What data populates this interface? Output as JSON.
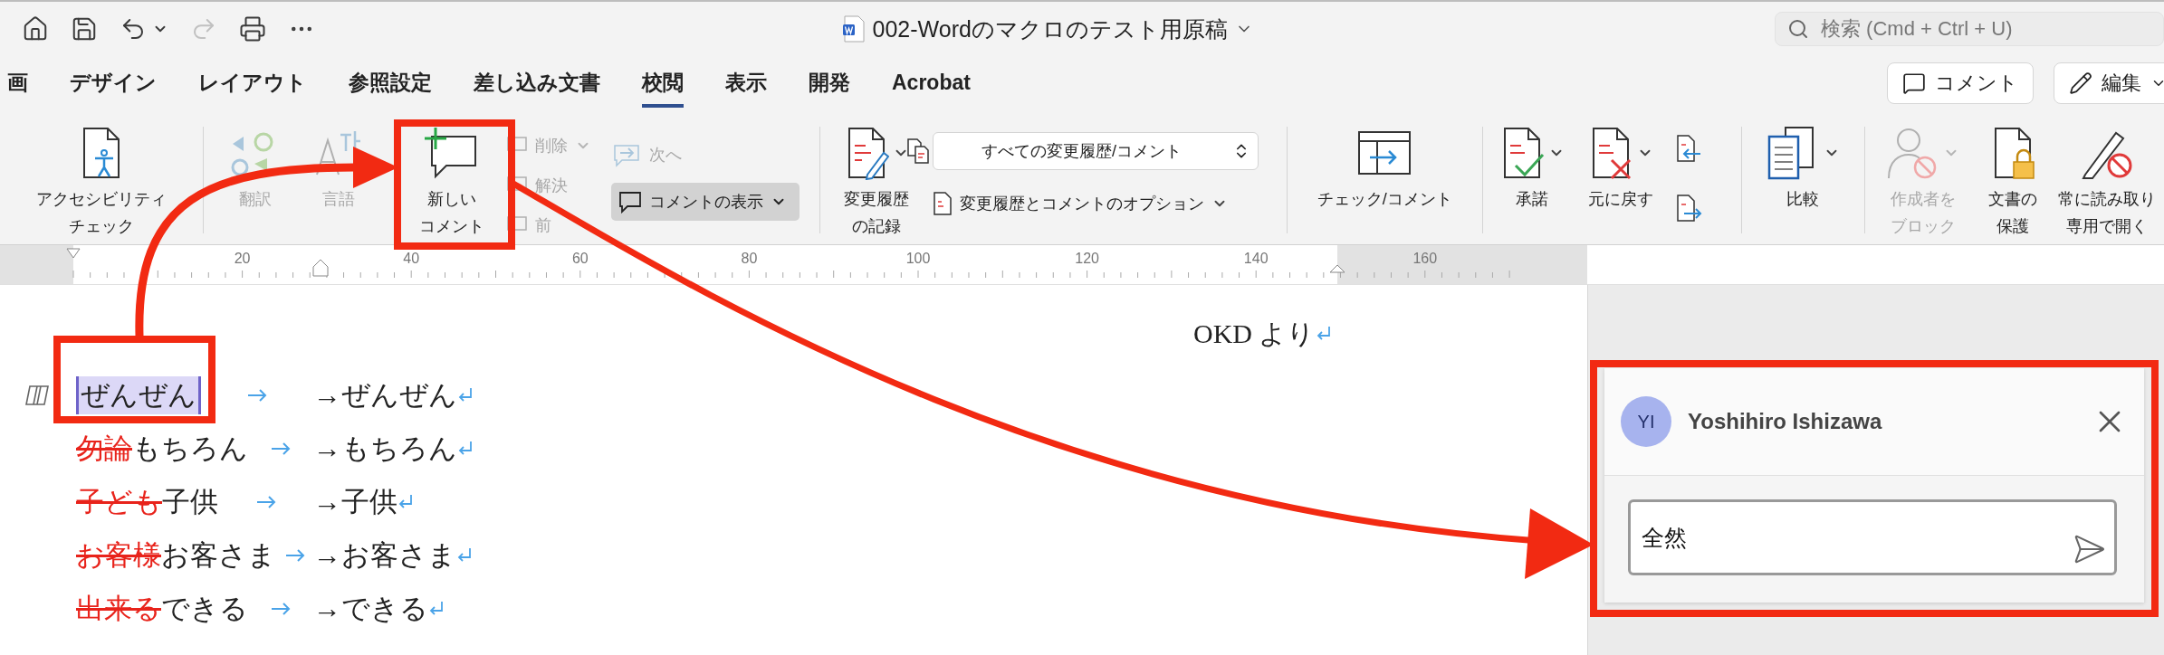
{
  "title_bar": {
    "title": "002-Wordのマクロのテスト用原稿",
    "search": {
      "placeholder": "検索 (Cmd + Ctrl + U)"
    }
  },
  "tabs": [
    {
      "label": "画",
      "selected": false
    },
    {
      "label": "デザイン",
      "selected": false
    },
    {
      "label": "レイアウト",
      "selected": false
    },
    {
      "label": "参照設定",
      "selected": false
    },
    {
      "label": "差し込み文書",
      "selected": false
    },
    {
      "label": "校閲",
      "selected": true
    },
    {
      "label": "表示",
      "selected": false
    },
    {
      "label": "開発",
      "selected": false
    },
    {
      "label": "Acrobat",
      "selected": false
    }
  ],
  "header_buttons": [
    {
      "label": "コメント"
    },
    {
      "label": "編集"
    }
  ],
  "ribbon": {
    "accessibility_check": {
      "label": [
        "アクセシビリティ",
        "チェック"
      ]
    },
    "translate": {
      "label": "翻訳",
      "disabled": true
    },
    "language": {
      "label": "言語",
      "disabled": true
    },
    "new_comment": {
      "label": [
        "新しい",
        "コメント"
      ]
    },
    "delete": {
      "label": "削除",
      "disabled": true
    },
    "resolve": {
      "label": "解決",
      "disabled": true
    },
    "previous": {
      "label": "前",
      "disabled": true
    },
    "next": {
      "label": "次へ",
      "disabled": true
    },
    "show_comments": {
      "label": "コメントの表示",
      "selected": true
    },
    "track_changes": {
      "label": [
        "変更履歴",
        "の記録"
      ]
    },
    "markup_select": {
      "value": "すべての変更履歴/コメント"
    },
    "markup_options": {
      "label": "変更履歴とコメントのオプション"
    },
    "check_comment": {
      "label": "チェック/コメント"
    },
    "accept": {
      "label": "承諾"
    },
    "reject": {
      "label": "元に戻す"
    },
    "compare": {
      "label": "比較"
    },
    "block_authors": {
      "label": [
        "作成者を",
        "ブロック"
      ],
      "disabled": true
    },
    "protect": {
      "label": [
        "文書の",
        "保護"
      ]
    },
    "read_only": {
      "label": [
        "常に読み取り",
        "専用で開く"
      ]
    }
  },
  "ruler": {
    "marks": [
      "20",
      "40",
      "60",
      "80",
      "100",
      "120",
      "140",
      "160"
    ]
  },
  "document": {
    "signature": "OKD より",
    "lines": [
      {
        "text": "ぜんぜん",
        "result": "→ぜんぜん",
        "commented": true
      },
      {
        "deleted": "勿論",
        "text": "もちろん",
        "result": "→もちろん",
        "commented": false
      },
      {
        "deleted": "子ども",
        "text": "子供",
        "result": "→子供",
        "commented": false
      },
      {
        "deleted": "お客様",
        "text": "お客さま",
        "result": "→お客さま",
        "commented": false
      },
      {
        "deleted": "出来る",
        "text": "できる",
        "result": "→できる",
        "commented": false
      }
    ]
  },
  "comment": {
    "initials": "YI",
    "author": "Yoshihiro Ishizawa",
    "draft": "全然"
  }
}
